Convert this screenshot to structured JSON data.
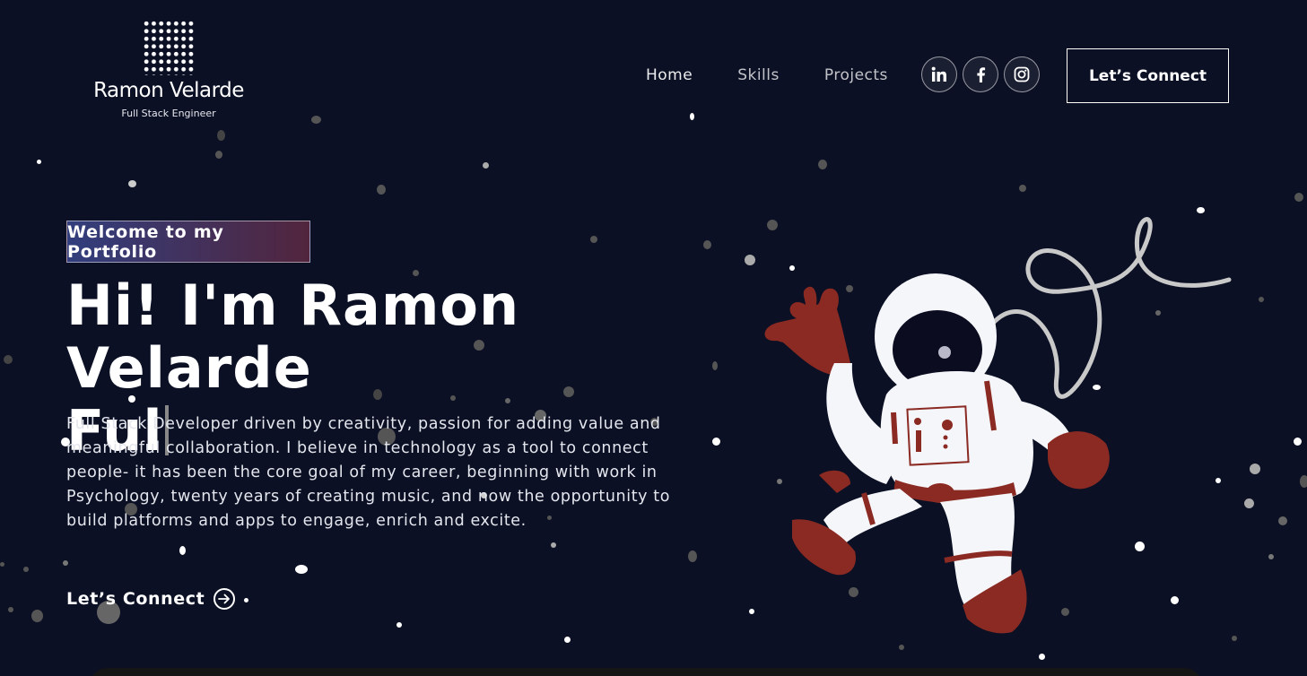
{
  "brand": {
    "name": "Ramon Velarde",
    "subtitle": "Full Stack Engineer"
  },
  "nav": {
    "home": "Home",
    "skills": "Skills",
    "projects": "Projects"
  },
  "social": {
    "linkedin_icon": "linkedin-icon",
    "facebook_icon": "facebook-icon",
    "instagram_icon": "instagram-icon"
  },
  "header_cta": "Let’s Connect",
  "hero": {
    "tagline": "Welcome to my Portfolio",
    "headline_line1": "Hi! I'm Ramon Velarde",
    "headline_line2": "Ful",
    "description": "Full Stack Developer driven by creativity, passion for adding value and meaningful collaboration. I believe in technology as a tool to connect people- it has been the core goal of my career, beginning with work in Psychology, twenty years of creating music, and now the opportunity to build platforms and apps to engage, enrich and excite.",
    "cta_label": "Let’s Connect"
  },
  "colors": {
    "background": "#0b1024",
    "accent_red": "#8a2a22",
    "text": "#ffffff"
  }
}
